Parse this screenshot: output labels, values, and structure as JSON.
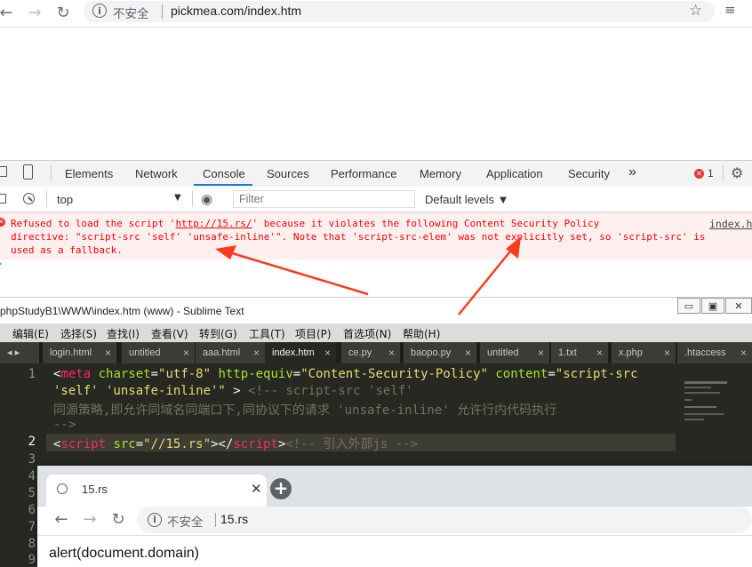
{
  "browser": {
    "insecure_label": "不安全",
    "url": "pickmea.com/index.htm"
  },
  "devtools": {
    "tabs": [
      "Elements",
      "Network",
      "Console",
      "Sources",
      "Performance",
      "Memory",
      "Application",
      "Security"
    ],
    "more": "»",
    "error_count": "1",
    "context": "top",
    "filter_placeholder": "Filter",
    "levels": "Default levels ▼",
    "error": {
      "line1_pre": "Refused to load the script '",
      "line1_link": "http://15.rs/",
      "line1_post": "' because it violates the following Content Security Policy",
      "line2": "directive: \"script-src 'self' 'unsafe-inline'\". Note that 'script-src-elem' was not explicitly set, so 'script-src' is",
      "line3": "used as a fallback.",
      "source": "index.h"
    }
  },
  "sublime": {
    "title": "phpStudyB1\\WWW\\index.htm (www) - Sublime Text",
    "menu": [
      "编辑(E)",
      "选择(S)",
      "查找(I)",
      "查看(V)",
      "转到(G)",
      "工具(T)",
      "项目(P)",
      "首选项(N)",
      "帮助(H)"
    ],
    "tabs": [
      "login.html",
      "untitled",
      "aaa.html",
      "index.htm",
      "ce.py",
      "baopo.py",
      "untitled",
      "1.txt",
      "x.php",
      ".htaccess"
    ],
    "active_tab": "index.htm",
    "line_numbers": [
      "1",
      "2",
      "3",
      "4",
      "5",
      "6",
      "7",
      "8",
      "9"
    ],
    "code": {
      "l1a_open": "<",
      "l1a_tag": "meta",
      "l1a_attr1": " charset",
      "l1a_eq1": "=",
      "l1a_val1": "\"utf-8\"",
      "l1a_attr2": " http-equiv",
      "l1a_eq2": "=",
      "l1a_val2": "\"Content-Security-Policy\"",
      "l1a_attr3": " content",
      "l1a_eq3": "=",
      "l1a_val3": "\"script-src",
      "l1b_val": "'self' 'unsafe-inline'\"",
      "l1b_close": " >",
      "l1b_cm": "<!-- script-src 'self'",
      "l1c_cm": "同源策略,即允许同域名同端口下,同协议下的请求 'unsafe-inline' 允许行内代码执行",
      "l1d_cm": "-->",
      "l2_open": "<",
      "l2_tag": "script",
      "l2_attr": " src",
      "l2_eq": "=",
      "l2_val": "\"//15.rs\"",
      "l2_mid": "></",
      "l2_tag2": "script",
      "l2_gt": ">",
      "l2_cm": "<!-- 引入外部js -->"
    }
  },
  "popup": {
    "tab_label": "15.rs",
    "insecure_label": "不安全",
    "url": "15.rs",
    "body_text": "alert(document.domain)"
  },
  "colors": {
    "arrow": "#ff3b1f",
    "error_text": "#fe0000",
    "editor_bg": "#272822"
  }
}
